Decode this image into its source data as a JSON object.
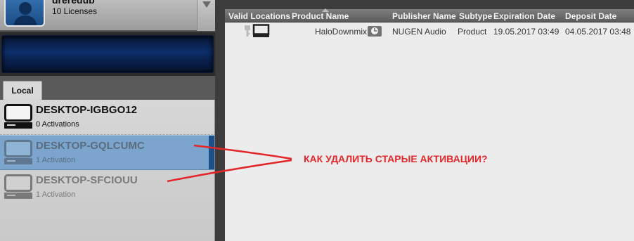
{
  "account": {
    "name": "dreredub",
    "licenses": "10 Licenses"
  },
  "tabs": [
    {
      "label": "Local",
      "active": true
    }
  ],
  "devices": [
    {
      "name": "DESKTOP-IGBGO12",
      "activations": "0 Activations",
      "state": "active"
    },
    {
      "name": "DESKTOP-GQLCUMC",
      "activations": "1 Activation",
      "state": "selected-inactive"
    },
    {
      "name": "DESKTOP-SFCIOUU",
      "activations": "1 Activation",
      "state": "inactive"
    }
  ],
  "table": {
    "columns": [
      "Valid Locations",
      "Product Name",
      "Publisher Name",
      "Subtype",
      "Expiration Date",
      "Deposit Date"
    ],
    "rows": [
      {
        "location_icons": [
          "key-icon",
          "computer-icon"
        ],
        "product": "HaloDownmix",
        "publisher_icon": "clock-icon",
        "publisher": "NUGEN Audio",
        "subtype": "Product",
        "expiration": "19.05.2017 03:49",
        "deposit": "04.05.2017 03:48"
      }
    ]
  },
  "annotation": {
    "text": "КАК УДАЛИТЬ СТАРЫЕ АКТИВАЦИИ?",
    "color": "#e3262a"
  },
  "colors": {
    "selection": "#7ba5cc",
    "selection_bar": "#1b4f8c",
    "banner": "#0d2f6c"
  }
}
